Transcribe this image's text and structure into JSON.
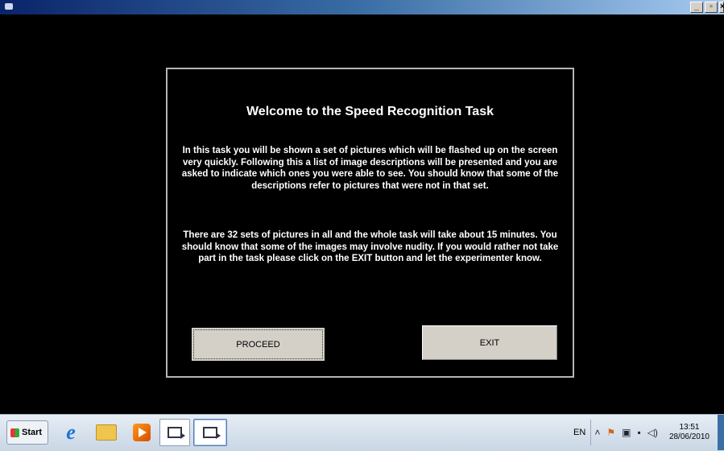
{
  "window": {
    "controls": [
      "_",
      "B",
      "X"
    ]
  },
  "dialog": {
    "title": "Welcome to the Speed Recognition Task",
    "paragraph1": "In this task you will be shown a set of pictures which will be flashed up on the screen very quickly.  Following this a list of image descriptions will be presented and you are asked to indicate which ones you were able to see.  You should know that some of the descriptions refer to pictures that were not in that set.",
    "paragraph2": "There are 32 sets of pictures in all and the whole task will take about 15 minutes.  You should know that some of the images may involve nudity.  If you would rather not take part in the task please click on the EXIT button and let the experimenter know.",
    "proceed_label": "PROCEED",
    "exit_label": "EXIT"
  },
  "taskbar": {
    "start_label": "Start",
    "language": "EN",
    "tray_chevron": "˄",
    "time": "13:51",
    "date": "28/06/2010"
  },
  "icons": [
    "windows-logo-icon",
    "internet-explorer-icon",
    "folder-icon",
    "media-player-icon",
    "window-icon",
    "up-arrow-icon",
    "flag-icon",
    "network-icon",
    "volume-icon"
  ]
}
